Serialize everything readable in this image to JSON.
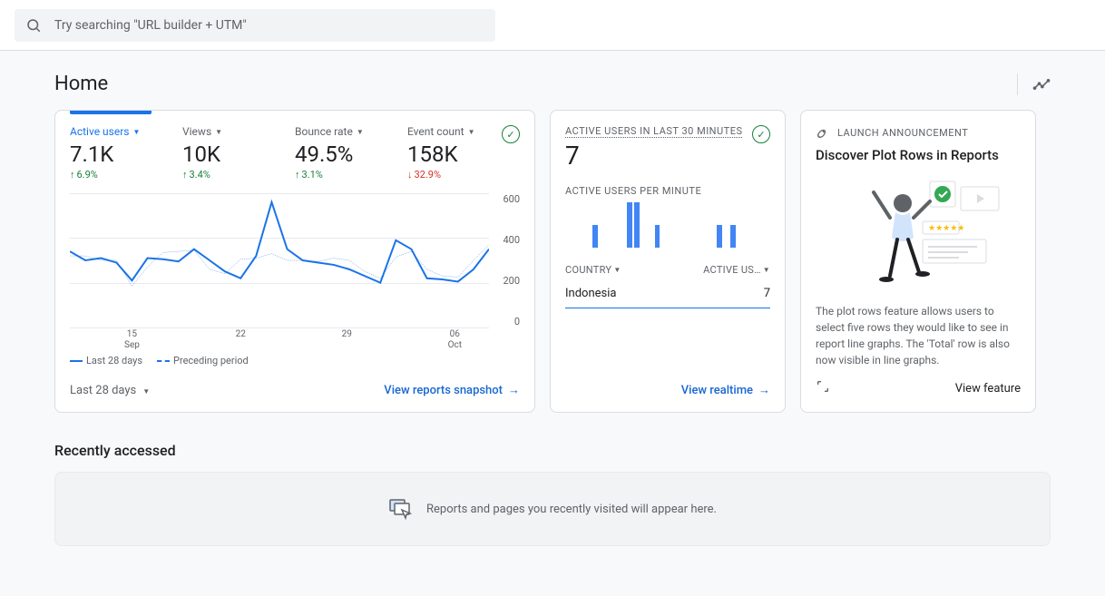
{
  "search": {
    "placeholder": "Try searching \"URL builder + UTM\""
  },
  "page_title": "Home",
  "metrics_card": {
    "metrics": [
      {
        "label": "Active users",
        "value": "7.1K",
        "delta": "6.9%",
        "direction": "up",
        "active": true
      },
      {
        "label": "Views",
        "value": "10K",
        "delta": "3.4%",
        "direction": "up",
        "active": false
      },
      {
        "label": "Bounce rate",
        "value": "49.5%",
        "delta": "3.1%",
        "direction": "up",
        "active": false
      },
      {
        "label": "Event count",
        "value": "158K",
        "delta": "32.9%",
        "direction": "down",
        "active": false
      }
    ],
    "legend": {
      "current": "Last 28 days",
      "previous": "Preceding period"
    },
    "range_selector": "Last 28 days",
    "footer_link": "View reports snapshot"
  },
  "chart_data": {
    "type": "line",
    "ylabel": "",
    "ylim": [
      0,
      600
    ],
    "yticks": [
      0,
      200,
      400,
      600
    ],
    "x_labels": [
      {
        "top": "15",
        "bottom": "Sep"
      },
      {
        "top": "22",
        "bottom": ""
      },
      {
        "top": "29",
        "bottom": ""
      },
      {
        "top": "06",
        "bottom": "Oct"
      }
    ],
    "series": [
      {
        "name": "Last 28 days",
        "style": "solid",
        "values": [
          340,
          300,
          310,
          290,
          210,
          310,
          305,
          295,
          350,
          300,
          250,
          220,
          320,
          560,
          350,
          300,
          290,
          280,
          260,
          230,
          200,
          390,
          350,
          220,
          215,
          205,
          260,
          350
        ]
      },
      {
        "name": "Preceding period",
        "style": "dashed",
        "values": [
          320,
          320,
          300,
          300,
          185,
          270,
          335,
          340,
          345,
          260,
          240,
          305,
          310,
          330,
          300,
          300,
          295,
          310,
          300,
          250,
          220,
          315,
          340,
          260,
          230,
          225,
          300,
          370
        ]
      }
    ]
  },
  "realtime_card": {
    "title": "ACTIVE USERS IN LAST 30 MINUTES",
    "value": "7",
    "per_minute_label": "ACTIVE USERS PER MINUTE",
    "per_minute_bars": [
      0,
      0,
      0,
      0,
      1,
      0,
      0,
      0,
      0,
      2,
      2,
      0,
      0,
      1,
      0,
      0,
      0,
      0,
      0,
      0,
      0,
      0,
      1,
      0,
      1,
      0,
      0,
      0,
      0,
      0
    ],
    "table": {
      "headers": [
        "COUNTRY",
        "ACTIVE US…"
      ],
      "rows": [
        {
          "country": "Indonesia",
          "users": "7"
        }
      ]
    },
    "footer_link": "View realtime"
  },
  "announcement_card": {
    "badge": "LAUNCH ANNOUNCEMENT",
    "title": "Discover Plot Rows in Reports",
    "body": "The plot rows feature allows users to select five rows they would like to see in report line graphs. The 'Total' row is also now visible in line graphs.",
    "footer_link": "View feature"
  },
  "recently_accessed": {
    "heading": "Recently accessed",
    "empty_message": "Reports and pages you recently visited will appear here."
  }
}
